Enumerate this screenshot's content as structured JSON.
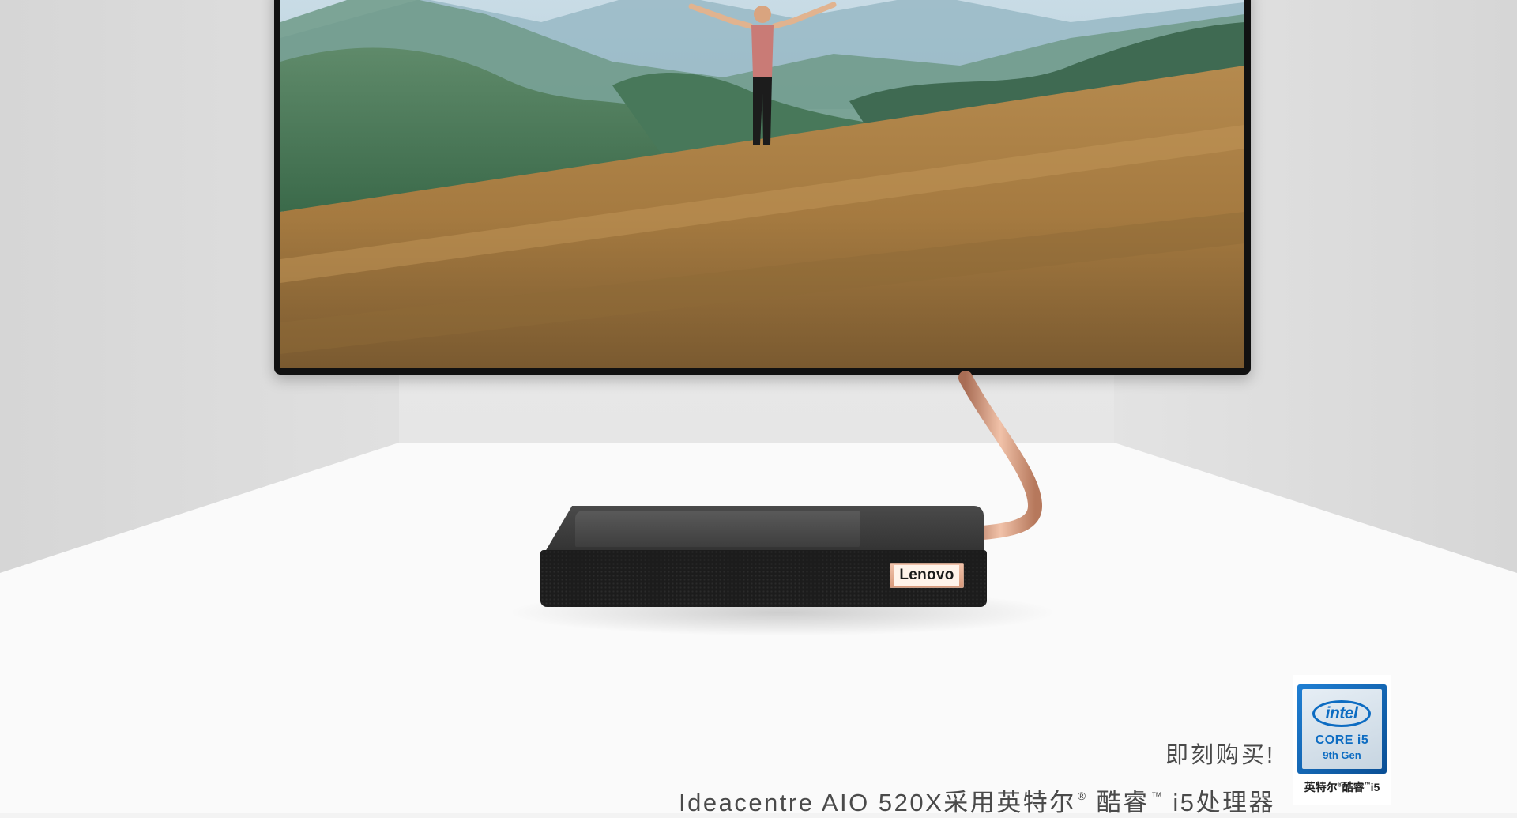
{
  "product_banner": {
    "headline": "即刻购买!",
    "subline_prefix": "Ideacentre AIO 520X采用英特尔",
    "subline_reg_mark": "®",
    "subline_mid": " 酷睿",
    "subline_tm_mark": "™",
    "subline_suffix": " i5处理器"
  },
  "device": {
    "brand_badge": "Lenovo"
  },
  "intel_badge": {
    "brand": "intel",
    "line": "CORE i5",
    "generation": "9th Gen",
    "caption_prefix": "英特尔",
    "caption_reg_mark": "®",
    "caption_mid": "酷睿",
    "caption_tm_mark": "™",
    "caption_suffix": "i5"
  },
  "colors": {
    "text": "#4a4a4a",
    "copper_stand": "#d99a7e",
    "intel_blue": "#0d6cc2"
  }
}
